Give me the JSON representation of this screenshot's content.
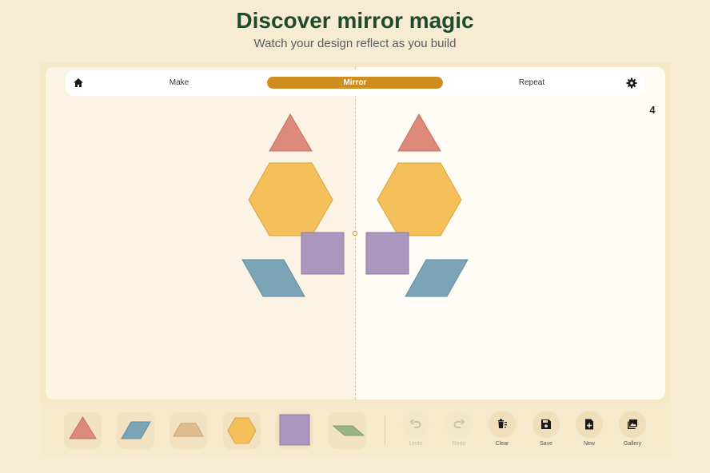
{
  "header": {
    "title": "Discover mirror magic",
    "subtitle": "Watch your design reflect as you build"
  },
  "nav": {
    "home_icon": "home-icon",
    "tabs": [
      {
        "label": "Make",
        "active": false
      },
      {
        "label": "Mirror",
        "active": true
      },
      {
        "label": "Repeat",
        "active": false
      }
    ],
    "settings_icon": "gear-icon"
  },
  "canvas": {
    "piece_count": "4",
    "pieces": [
      "triangle",
      "hexagon",
      "square",
      "rhombus"
    ]
  },
  "palette": {
    "shapes": [
      {
        "name": "triangle",
        "color": "#dd8a7b"
      },
      {
        "name": "rhombus",
        "color": "#7ba5b7"
      },
      {
        "name": "trapezoid",
        "color": "#dfbc8e"
      },
      {
        "name": "hexagon",
        "color": "#f5c05a"
      },
      {
        "name": "square",
        "color": "#ab96bd"
      },
      {
        "name": "thin-rhombus",
        "color": "#9ab482"
      }
    ]
  },
  "actions": [
    {
      "label": "Undo",
      "icon": "undo-icon",
      "enabled": false
    },
    {
      "label": "Redo",
      "icon": "redo-icon",
      "enabled": false
    },
    {
      "label": "Clear",
      "icon": "trash-icon",
      "enabled": true
    },
    {
      "label": "Save",
      "icon": "save-icon",
      "enabled": true
    },
    {
      "label": "New",
      "icon": "new-file-icon",
      "enabled": true
    },
    {
      "label": "Gallery",
      "icon": "gallery-icon",
      "enabled": true
    }
  ],
  "colors": {
    "accent": "#cf8d22",
    "title": "#1f4a2d",
    "triangle": "#dd8a7b",
    "hexagon": "#f5c05a",
    "square": "#ab96bd",
    "rhombus": "#7ba5b7"
  }
}
